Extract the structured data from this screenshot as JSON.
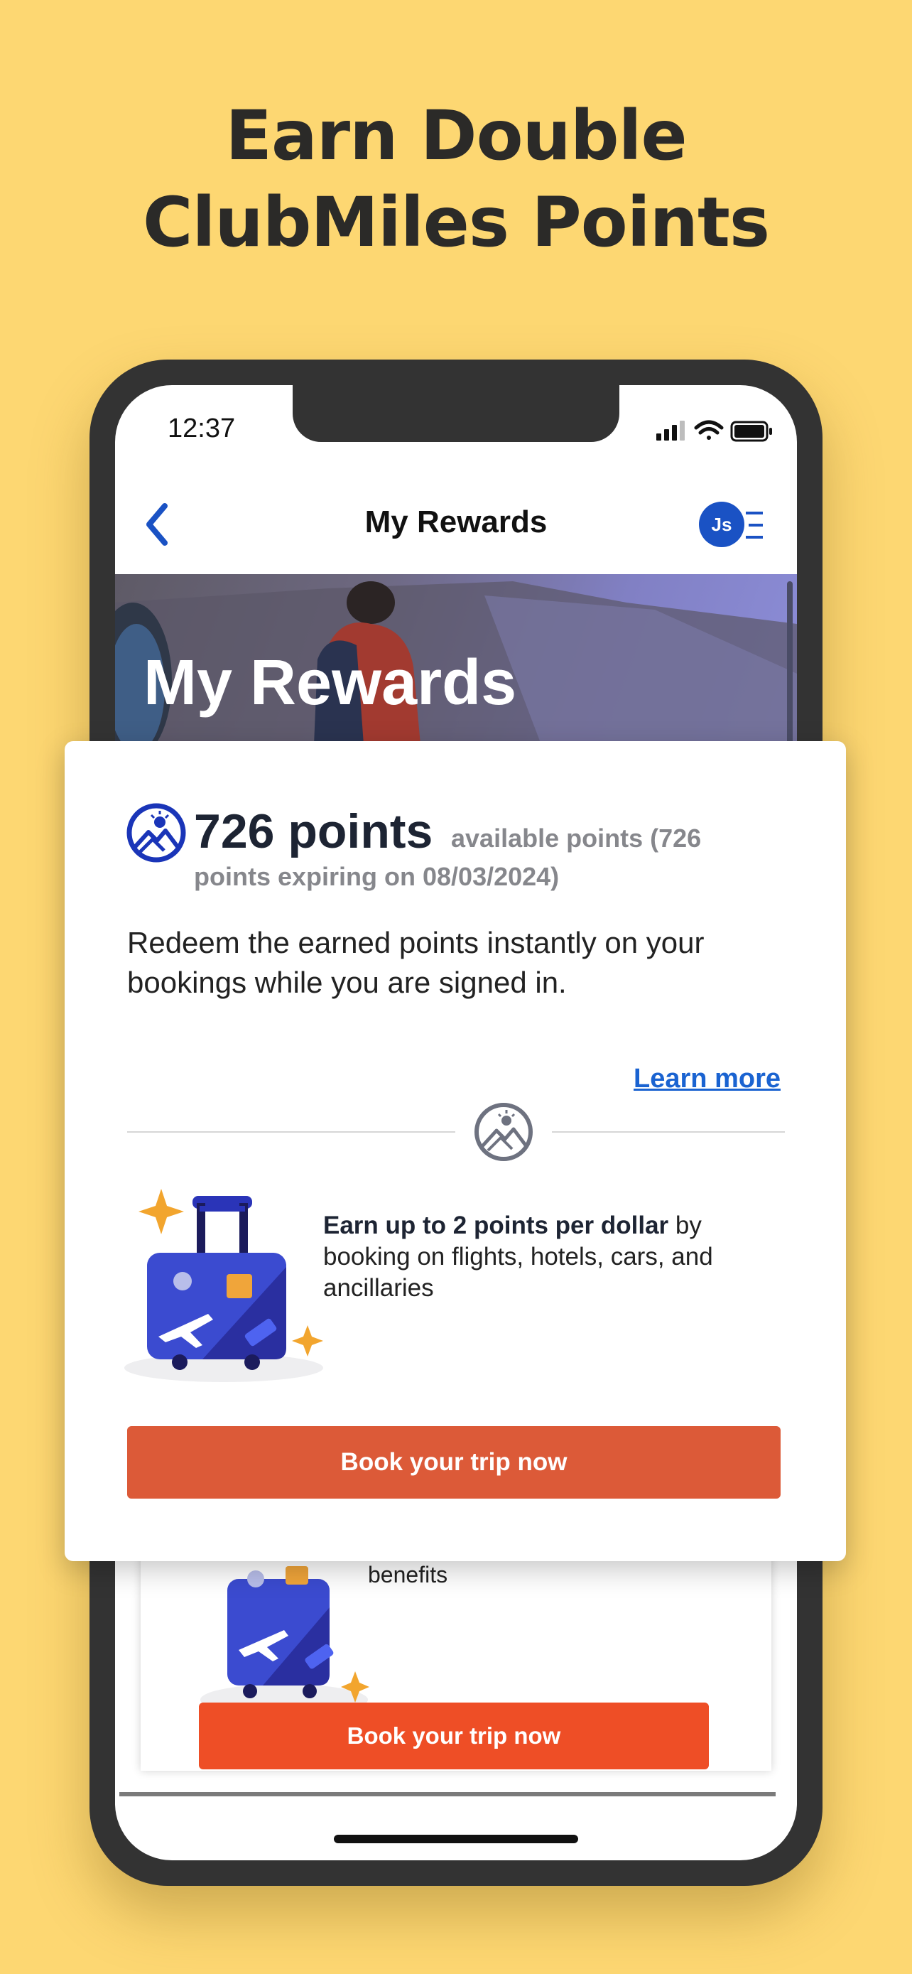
{
  "headline": {
    "line1": "Earn Double",
    "line2": "ClubMiles Points"
  },
  "status_bar": {
    "time": "12:37",
    "icons": [
      "cellular-signal-icon",
      "wifi-icon",
      "battery-icon"
    ]
  },
  "nav": {
    "title": "My Rewards",
    "back_icon": "chevron-left-icon",
    "avatar_initials": "Js",
    "menu_icon": "menu-icon"
  },
  "hero": {
    "title": "My Rewards"
  },
  "rewards_card": {
    "points_value": "726 points",
    "points_note": "available points (726 points expiring on 08/03/2024)",
    "description": "Redeem the earned points instantly on your bookings while you are signed in.",
    "learn_more": "Learn more",
    "earn_bold": "Earn up to 2 points per dollar",
    "earn_rest": " by booking on flights, hotels, cars, and ancillaries",
    "book_button": "Book your trip now"
  },
  "background_card": {
    "benefits_text": "benefits",
    "book_button": "Book your trip now"
  },
  "colors": {
    "background": "#FDD772",
    "brand_blue": "#1A52C4",
    "cta_orange": "#DC5A38",
    "link_blue": "#1A63D1"
  }
}
